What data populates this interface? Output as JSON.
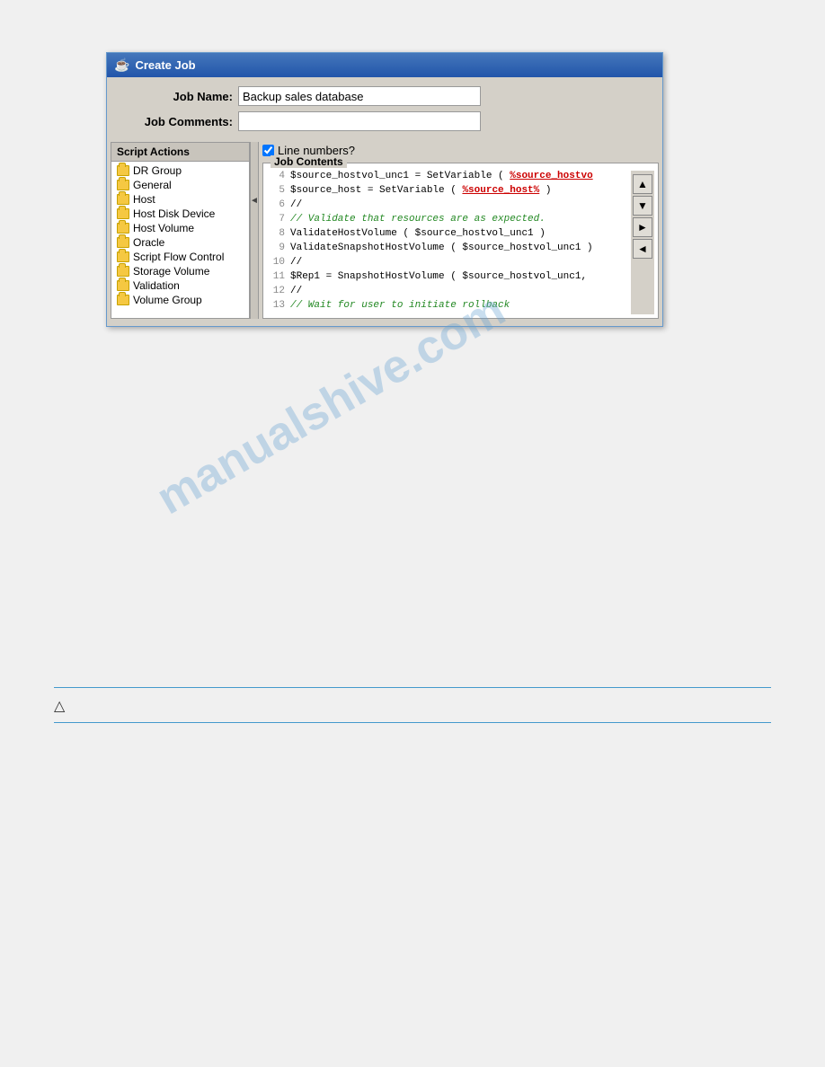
{
  "dialog": {
    "title": "Create Job",
    "title_icon": "☕"
  },
  "form": {
    "job_name_label": "Job Name:",
    "job_name_value": "Backup sales database",
    "job_comments_label": "Job Comments:",
    "job_comments_value": ""
  },
  "script_actions": {
    "header": "Script Actions",
    "items": [
      "DR Group",
      "General",
      "Host",
      "Host Disk Device",
      "Host Volume",
      "Oracle",
      "Script Flow Control",
      "Storage Volume",
      "Validation",
      "Volume Group"
    ]
  },
  "line_numbers": {
    "label": "Line numbers?",
    "checked": true
  },
  "job_contents": {
    "label": "Job Contents",
    "lines": [
      {
        "num": "4",
        "text": "$source_hostvol_unc1 = SetVariable ( %source_hostvo",
        "style": "mixed1"
      },
      {
        "num": "5",
        "text": "$source_host = SetVariable ( %source_host% )",
        "style": "mixed2"
      },
      {
        "num": "6",
        "text": "//",
        "style": "comment"
      },
      {
        "num": "7",
        "text": "// Validate that resources are as expected.",
        "style": "green-italic"
      },
      {
        "num": "8",
        "text": "ValidateHostVolume ( $source_hostvol_unc1 )",
        "style": "black"
      },
      {
        "num": "9",
        "text": "ValidateSnapshotHostVolume ( $source_hostvol_unc1 )",
        "style": "black"
      },
      {
        "num": "10",
        "text": "//",
        "style": "comment"
      },
      {
        "num": "11",
        "text": "$Rep1 = SnapshotHostVolume ( $source_hostvol_unc1,",
        "style": "black"
      },
      {
        "num": "12",
        "text": "//",
        "style": "comment"
      },
      {
        "num": "13",
        "text": "// Wait for user to initiate rollback",
        "style": "green-italic-partial"
      }
    ]
  },
  "nav_buttons": {
    "up": "▲",
    "down": "▼",
    "right": "►",
    "left": "◄"
  },
  "warning": {
    "icon": "△",
    "text": ""
  },
  "watermark": "manualshive.com"
}
